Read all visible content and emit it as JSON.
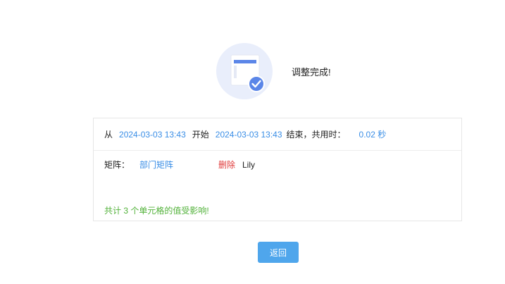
{
  "result": {
    "title": "调整完成!"
  },
  "summary": {
    "from_label": "从",
    "start_time": "2024-03-03 13:43",
    "start_label": "开始",
    "end_time": "2024-03-03 13:43",
    "end_label": "结束，共用时：",
    "duration": "0.02 秒"
  },
  "detail": {
    "matrix_label": "矩阵：",
    "matrix_name": "部门矩阵",
    "action": "删除",
    "user": "Lily"
  },
  "affected_text": "共计 3 个单元格的值受影响!",
  "back_label": "返回",
  "colors": {
    "link": "#3a8ee6",
    "danger": "#e03b3b",
    "success": "#52b23a",
    "button": "#4fa6ec"
  },
  "icons": {
    "result": "document-check-icon"
  }
}
